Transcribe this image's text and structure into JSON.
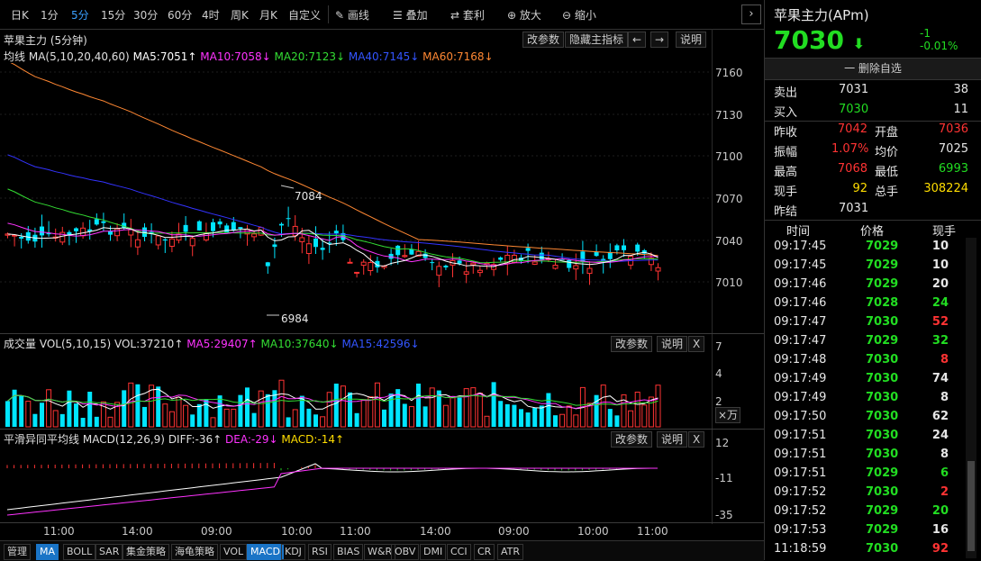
{
  "toolbar": {
    "periods": [
      "日K",
      "1分",
      "5分",
      "15分",
      "30分",
      "60分",
      "4时",
      "周K",
      "月K",
      "自定义"
    ],
    "active_period": "5分",
    "tools": [
      "画线",
      "叠加",
      "套利",
      "放大",
      "缩小"
    ],
    "collapse_glyph": "›"
  },
  "main_panel": {
    "title": "苹果主力 (5分钟)",
    "buttons": [
      "改参数",
      "隐藏主指标",
      "←",
      "→",
      "说明"
    ],
    "ma_line": {
      "label": "均线",
      "params": "MA(5,10,20,40,60)",
      "ma5": "MA5:7051↑",
      "ma10": "MA10:7058↓",
      "ma20": "MA20:7123↓",
      "ma40": "MA40:7145↓",
      "ma60": "MA60:7168↓"
    },
    "y_ticks": [
      "7160",
      "7130",
      "7100",
      "7070",
      "7040",
      "7010"
    ],
    "high_marker": "7084",
    "low_marker": "6984"
  },
  "volume_panel": {
    "title": "成交量",
    "params": "VOL(5,10,15)",
    "vol": "VOL:37210↑",
    "ma5": "MA5:29407↑",
    "ma10": "MA10:37640↓",
    "ma15": "MA15:42596↓",
    "buttons": [
      "改参数",
      "说明",
      "X"
    ],
    "y_ticks": [
      "7",
      "4",
      "2"
    ],
    "unit_button": "×万"
  },
  "macd_panel": {
    "title": "平滑异同平均线",
    "params": "MACD(12,26,9)",
    "diff": "DIFF:-36↑",
    "dea": "DEA:-29↓",
    "macd": "MACD:-14↑",
    "buttons": [
      "改参数",
      "说明",
      "X"
    ],
    "y_ticks": [
      "12",
      "-11",
      "-35"
    ]
  },
  "time_axis": [
    "11:00",
    "14:00",
    "09:00",
    "10:00",
    "11:00",
    "14:00",
    "09:00",
    "10:00",
    "11:00"
  ],
  "bottom_tabs": [
    "管理",
    "MA",
    "BOLL",
    "SAR",
    "集金策略",
    "海龟策略",
    "VOL",
    "MACD",
    "KDJ",
    "RSI",
    "BIAS",
    "W&R",
    "OBV",
    "DMI",
    "CCI",
    "CR",
    "ATR"
  ],
  "active_tabs": [
    "MA",
    "MACD"
  ],
  "quote": {
    "name": "苹果主力(APm)",
    "price": "7030",
    "arrow": "⬇",
    "change": "-1",
    "change_pct": "-0.01%",
    "remove_label": "一 删除自选",
    "sell_label": "卖出",
    "sell_price": "7031",
    "sell_vol": "38",
    "buy_label": "买入",
    "buy_price": "7030",
    "buy_vol": "11",
    "stats": [
      {
        "l1": "昨收",
        "v1": "7042",
        "c1": "red",
        "l2": "开盘",
        "v2": "7036",
        "c2": "red"
      },
      {
        "l1": "振幅",
        "v1": "1.07%",
        "c1": "red",
        "l2": "均价",
        "v2": "7025",
        "c2": "white"
      },
      {
        "l1": "最高",
        "v1": "7068",
        "c1": "red",
        "l2": "最低",
        "v2": "6993",
        "c2": "green"
      },
      {
        "l1": "现手",
        "v1": "92",
        "c1": "yellow",
        "l2": "总手",
        "v2": "308224",
        "c2": "yellow"
      }
    ],
    "settle_label": "昨结",
    "settle_value": "7031"
  },
  "trades": {
    "headers": [
      "时间",
      "价格",
      "现手"
    ],
    "rows": [
      {
        "time": "09:17:45",
        "price": "7029",
        "vol": "10",
        "vc": "white"
      },
      {
        "time": "09:17:45",
        "price": "7029",
        "vol": "10",
        "vc": "white"
      },
      {
        "time": "09:17:46",
        "price": "7029",
        "vol": "20",
        "vc": "white"
      },
      {
        "time": "09:17:46",
        "price": "7028",
        "vol": "24",
        "vc": "green"
      },
      {
        "time": "09:17:47",
        "price": "7030",
        "vol": "52",
        "vc": "red"
      },
      {
        "time": "09:17:47",
        "price": "7029",
        "vol": "32",
        "vc": "green"
      },
      {
        "time": "09:17:48",
        "price": "7030",
        "vol": "8",
        "vc": "red"
      },
      {
        "time": "09:17:49",
        "price": "7030",
        "vol": "74",
        "vc": "white"
      },
      {
        "time": "09:17:49",
        "price": "7030",
        "vol": "8",
        "vc": "white"
      },
      {
        "time": "09:17:50",
        "price": "7030",
        "vol": "62",
        "vc": "white"
      },
      {
        "time": "09:17:51",
        "price": "7030",
        "vol": "24",
        "vc": "white"
      },
      {
        "time": "09:17:51",
        "price": "7030",
        "vol": "8",
        "vc": "white"
      },
      {
        "time": "09:17:51",
        "price": "7029",
        "vol": "6",
        "vc": "green"
      },
      {
        "time": "09:17:52",
        "price": "7030",
        "vol": "2",
        "vc": "red"
      },
      {
        "time": "09:17:52",
        "price": "7029",
        "vol": "20",
        "vc": "green"
      },
      {
        "time": "09:17:53",
        "price": "7029",
        "vol": "16",
        "vc": "white"
      },
      {
        "time": "11:18:59",
        "price": "7030",
        "vol": "92",
        "vc": "red"
      }
    ]
  },
  "colors": {
    "up": "#ff3333",
    "down": "#00e5ff",
    "ma5": "#ffffff",
    "ma10": "#ff33ff",
    "ma20": "#33dd33",
    "ma40": "#3333ff",
    "ma60": "#ff8833",
    "price_green": "#22dd22"
  }
}
